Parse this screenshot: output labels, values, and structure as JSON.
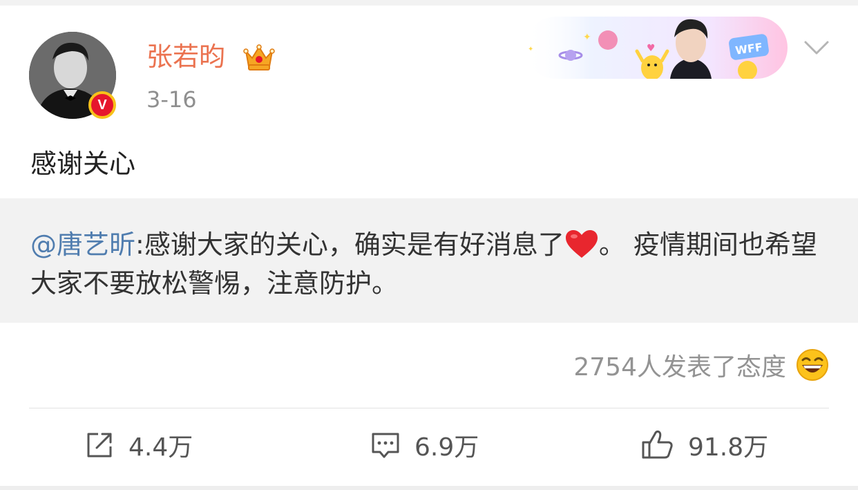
{
  "post": {
    "username": "张若昀",
    "time": "3-16",
    "text": "感谢关心"
  },
  "repost": {
    "mention": "@唐艺昕",
    "text_before_emoji": ":感谢大家的关心，确实是有好消息了",
    "emoji": "red-heart",
    "text_after_emoji": "。 疫情期间也希望大家不要放松警惕，注意防护。"
  },
  "attitude": {
    "label": "2754人发表了态度"
  },
  "actions": {
    "repost_count": "4.4万",
    "comment_count": "6.9万",
    "like_count": "91.8万"
  },
  "banner": {
    "badge_text": "WFF"
  },
  "colors": {
    "username": "#eb7350",
    "mention": "#507daf",
    "verified_badge": "#e6162d",
    "repost_bg": "#f2f2f2"
  }
}
